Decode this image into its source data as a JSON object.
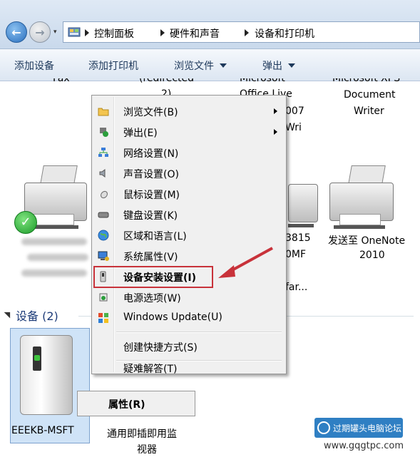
{
  "address": {
    "crumbs": [
      "控制面板",
      "硬件和声音",
      "设备和打印机"
    ],
    "nav_dropdown": "▾"
  },
  "toolbar": {
    "add_device": "添加设备",
    "add_printer": "添加打印机",
    "browse_files": "浏览文件",
    "eject": "弹出"
  },
  "devices": {
    "fax": "Fax",
    "redirected_2": "(redirected",
    "redirected_2b": "2)",
    "office_live_1": "Microsoft",
    "office_live_2": "Office Live",
    "office_live_3": "007",
    "office_live_4": "Wri",
    "xps_1": "Microsoft XPS",
    "xps_2": "Document",
    "xps_3": "Writer",
    "mid_1": "3815",
    "mid_2": "0MF",
    "mid_3": "far...",
    "onenote_1": "发送至 OneNote",
    "onenote_2": "2010"
  },
  "section": {
    "title": "设备 (2)"
  },
  "dev2": {
    "eeekb": "EEEKB-MSFT",
    "monitor_1": "通用即插即用监",
    "monitor_2": "视器"
  },
  "menu": {
    "items": [
      {
        "label": "浏览文件(B)",
        "icon": "folder-icon",
        "submenu": true
      },
      {
        "label": "弹出(E)",
        "icon": "eject-icon",
        "submenu": true
      },
      {
        "label": "网络设置(N)",
        "icon": "network-icon"
      },
      {
        "label": "声音设置(O)",
        "icon": "speaker-icon"
      },
      {
        "label": "鼠标设置(M)",
        "icon": "mouse-icon"
      },
      {
        "label": "键盘设置(K)",
        "icon": "keyboard-icon"
      },
      {
        "label": "区域和语言(L)",
        "icon": "globe-icon"
      },
      {
        "label": "系统属性(V)",
        "icon": "computer-icon"
      },
      {
        "label": "设备安装设置(I)",
        "icon": "device-install-icon"
      },
      {
        "label": "电源选项(W)",
        "icon": "power-icon"
      },
      {
        "label": "Windows Update(U)",
        "icon": "windows-update-icon"
      },
      {
        "label": "创建快捷方式(S)"
      },
      {
        "label": "疑难解答(T)"
      }
    ],
    "properties": "属性(R)"
  },
  "watermark": {
    "name": "过期罐头电脑论坛",
    "url": "www.gqgtpc.com"
  },
  "colors": {
    "highlight_box": "#c8323a",
    "toolbar_text": "#1e395b",
    "section_text": "#1e3c78"
  }
}
